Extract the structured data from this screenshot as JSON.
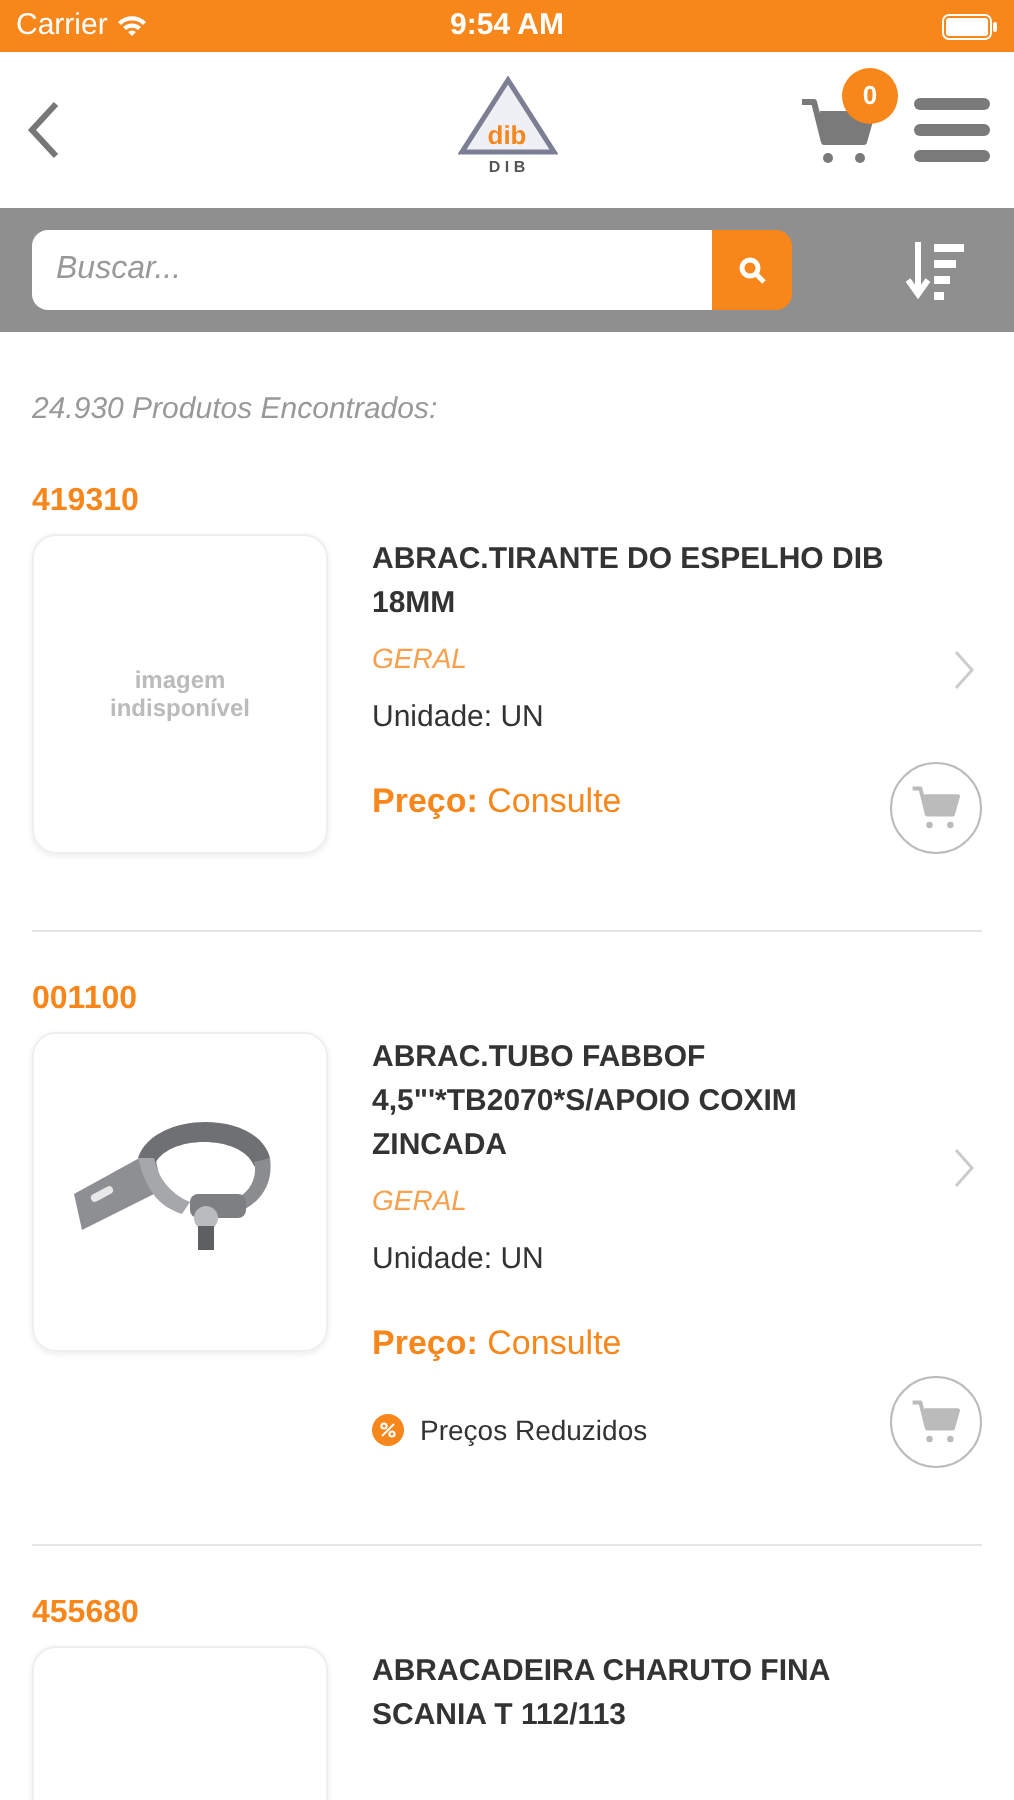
{
  "status_bar": {
    "carrier": "Carrier",
    "time": "9:54 AM"
  },
  "header": {
    "logo": {
      "mark": "dib",
      "caption": "D I B"
    },
    "cart_count": "0"
  },
  "search": {
    "placeholder": "Buscar..."
  },
  "results_count": "24.930 Produtos Encontrados:",
  "products": [
    {
      "code": "419310",
      "image": {
        "kind": "placeholder",
        "text": "imagem indisponível"
      },
      "title": "ABRAC.TIRANTE DO ESPELHO DIB 18MM",
      "category": "GERAL",
      "unit": "Unidade: UN",
      "price_label": "Preço:",
      "price": "Consulte"
    },
    {
      "code": "001100",
      "title": "ABRAC.TUBO FABBOF 4,5\"'*TB2070*S/APOIO COXIM ZINCADA",
      "category": "GERAL",
      "unit": "Unidade: UN",
      "price_label": "Preço:",
      "price": "Consulte",
      "badge": "Preços Reduzidos"
    },
    {
      "code": "455680",
      "image": {
        "kind": "blank"
      },
      "title": "ABRACADEIRA CHARUTO FINA SCANIA T 112/113"
    }
  ]
}
